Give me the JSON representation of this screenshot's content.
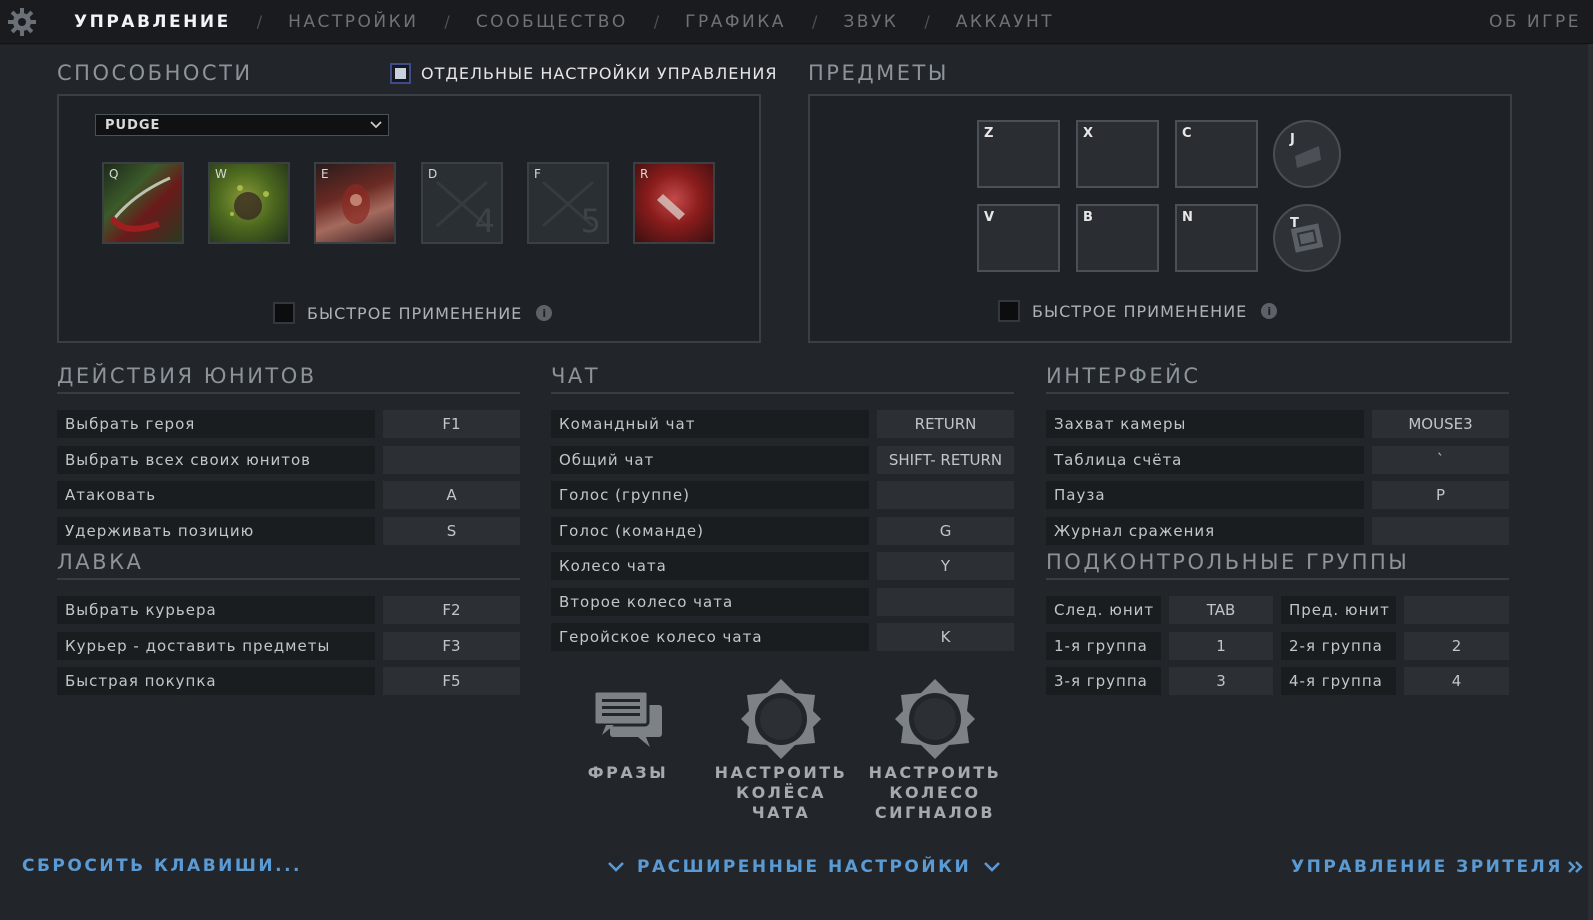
{
  "nav": {
    "tabs": [
      "УПРАВЛЕНИЕ",
      "НАСТРОЙКИ",
      "СООБЩЕСТВО",
      "ГРАФИКА",
      "ЗВУК",
      "АККАУНТ"
    ],
    "active_tab": "УПРАВЛЕНИЕ",
    "separator": "/",
    "about": "ОБ ИГРЕ"
  },
  "abilities": {
    "title": "СПОСОБНОСТИ",
    "override_label": "ОТДЕЛЬНЫЕ НАСТРОЙКИ УПРАВЛЕНИЯ",
    "hero": "PUDGE",
    "slots": [
      {
        "key": "Q",
        "num": ""
      },
      {
        "key": "W",
        "num": ""
      },
      {
        "key": "E",
        "num": ""
      },
      {
        "key": "D",
        "num": "4"
      },
      {
        "key": "F",
        "num": "5"
      },
      {
        "key": "R",
        "num": ""
      }
    ],
    "quickcast_label": "БЫСТРОЕ ПРИМЕНЕНИЕ"
  },
  "items": {
    "title": "ПРЕДМЕТЫ",
    "row1": [
      "Z",
      "X",
      "C"
    ],
    "row2": [
      "V",
      "B",
      "N"
    ],
    "neutral_key": "J",
    "tp_key": "T",
    "quickcast_label": "БЫСТРОЕ ПРИМЕНЕНИЕ"
  },
  "unit_actions": {
    "title": "ДЕЙСТВИЯ ЮНИТОВ",
    "rows": [
      {
        "label": "Выбрать героя",
        "key": "F1"
      },
      {
        "label": "Выбрать всех своих юнитов",
        "key": ""
      },
      {
        "label": "Атаковать",
        "key": "A"
      },
      {
        "label": "Удерживать позицию",
        "key": "S"
      }
    ]
  },
  "shop": {
    "title": "ЛАВКА",
    "rows": [
      {
        "label": "Выбрать курьера",
        "key": "F2"
      },
      {
        "label": "Курьер - доставить предметы",
        "key": "F3"
      },
      {
        "label": "Быстрая покупка",
        "key": "F5"
      }
    ]
  },
  "chat": {
    "title": "ЧАТ",
    "rows": [
      {
        "label": "Командный чат",
        "key": "RETURN"
      },
      {
        "label": "Общий чат",
        "key": "SHIFT- RETURN"
      },
      {
        "label": "Голос (группе)",
        "key": ""
      },
      {
        "label": "Голос (команде)",
        "key": "G"
      },
      {
        "label": "Колесо чата",
        "key": "Y"
      },
      {
        "label": "Второе колесо чата",
        "key": ""
      },
      {
        "label": "Геройское колесо чата",
        "key": "K"
      }
    ]
  },
  "interface": {
    "title": "ИНТЕРФЕЙС",
    "rows": [
      {
        "label": "Захват камеры",
        "key": "MOUSE3"
      },
      {
        "label": "Таблица счёта",
        "key": "`"
      },
      {
        "label": "Пауза",
        "key": "P"
      },
      {
        "label": "Журнал сражения",
        "key": ""
      }
    ]
  },
  "control_groups": {
    "title": "ПОДКОНТРОЛЬНЫЕ ГРУППЫ",
    "rows": [
      {
        "l1": "След. юнит",
        "v1": "TAB",
        "l2": "Пред. юнит",
        "v2": ""
      },
      {
        "l1": "1-я группа",
        "v1": "1",
        "l2": "2-я группа",
        "v2": "2"
      },
      {
        "l1": "3-я группа",
        "v1": "3",
        "l2": "4-я группа",
        "v2": "4"
      }
    ]
  },
  "tools": {
    "phrases": "ФРАЗЫ",
    "chat_wheel": [
      "НАСТРОИТЬ",
      "КОЛЁСА ЧАТА"
    ],
    "ping_wheel": [
      "НАСТРОИТЬ",
      "КОЛЕСО",
      "СИГНАЛОВ"
    ]
  },
  "footer": {
    "reset": "СБРОСИТЬ КЛАВИШИ...",
    "advanced": "РАСШИРЕННЫЕ НАСТРОЙКИ",
    "spectator": "УПРАВЛЕНИЕ ЗРИТЕЛЯ"
  },
  "colors": {
    "background": "#22262a",
    "accent": "#5b9bd5",
    "active_tab": "#f2f4f5"
  }
}
